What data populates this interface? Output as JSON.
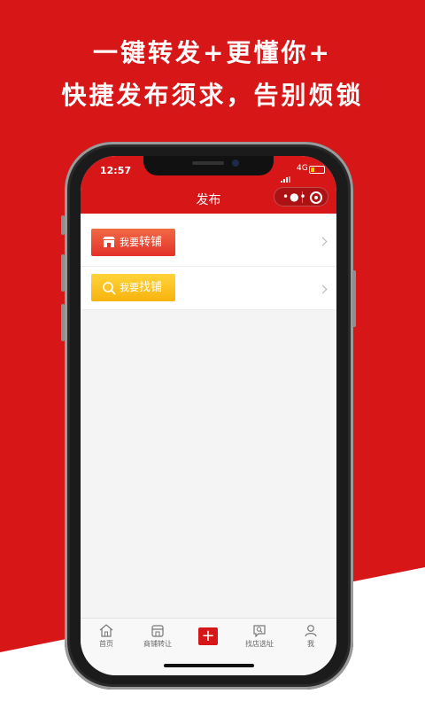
{
  "headline": {
    "line1": "一键转发+更懂你+",
    "line2": "快捷发布须求，告别烦锁"
  },
  "status_bar": {
    "time": "12:57",
    "network": "4G"
  },
  "navbar": {
    "title": "发布"
  },
  "actions": [
    {
      "small": "我要",
      "big": "转铺",
      "icon": "shop-icon"
    },
    {
      "small": "我要",
      "big": "找铺",
      "icon": "magnifier-icon"
    }
  ],
  "tabbar": {
    "items": [
      {
        "label": "首页",
        "icon": "home-icon"
      },
      {
        "label": "商铺转让",
        "icon": "store-icon"
      },
      {
        "label": "",
        "icon": "plus-icon"
      },
      {
        "label": "找店选址",
        "icon": "chat-search-icon"
      },
      {
        "label": "我",
        "icon": "person-icon"
      }
    ]
  },
  "colors": {
    "brand_red": "#d71618",
    "transfer_button": "#e4312a",
    "find_button": "#f7b30e"
  }
}
